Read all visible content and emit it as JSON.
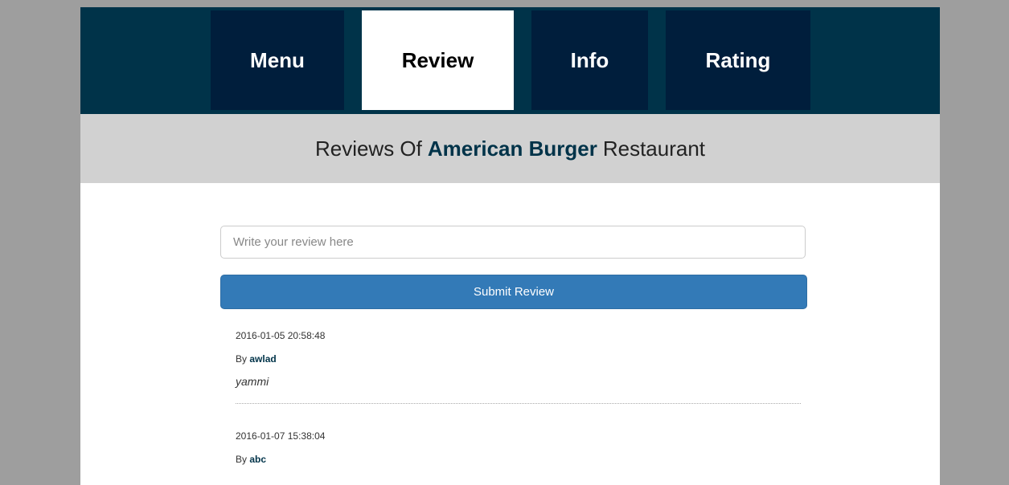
{
  "nav": {
    "tabs": [
      {
        "label": "Menu",
        "active": false
      },
      {
        "label": "Review",
        "active": true
      },
      {
        "label": "Info",
        "active": false
      },
      {
        "label": "Rating",
        "active": false
      }
    ]
  },
  "title": {
    "prefix": "Reviews Of",
    "restaurant": "American Burger",
    "suffix": "Restaurant"
  },
  "review_form": {
    "placeholder": "Write your review here",
    "submit_label": "Submit Review"
  },
  "reviews": [
    {
      "date": "2016-01-05 20:58:48",
      "by_label": "By",
      "author": "awlad",
      "text": "yammi"
    },
    {
      "date": "2016-01-07 15:38:04",
      "by_label": "By",
      "author": "abc",
      "text": ""
    }
  ],
  "colors": {
    "nav_bg": "#003349",
    "tab_bg": "#001e3c",
    "accent": "#003349",
    "button": "#337ab7",
    "band": "#d1d1d1",
    "backdrop": "#9e9e9e"
  }
}
